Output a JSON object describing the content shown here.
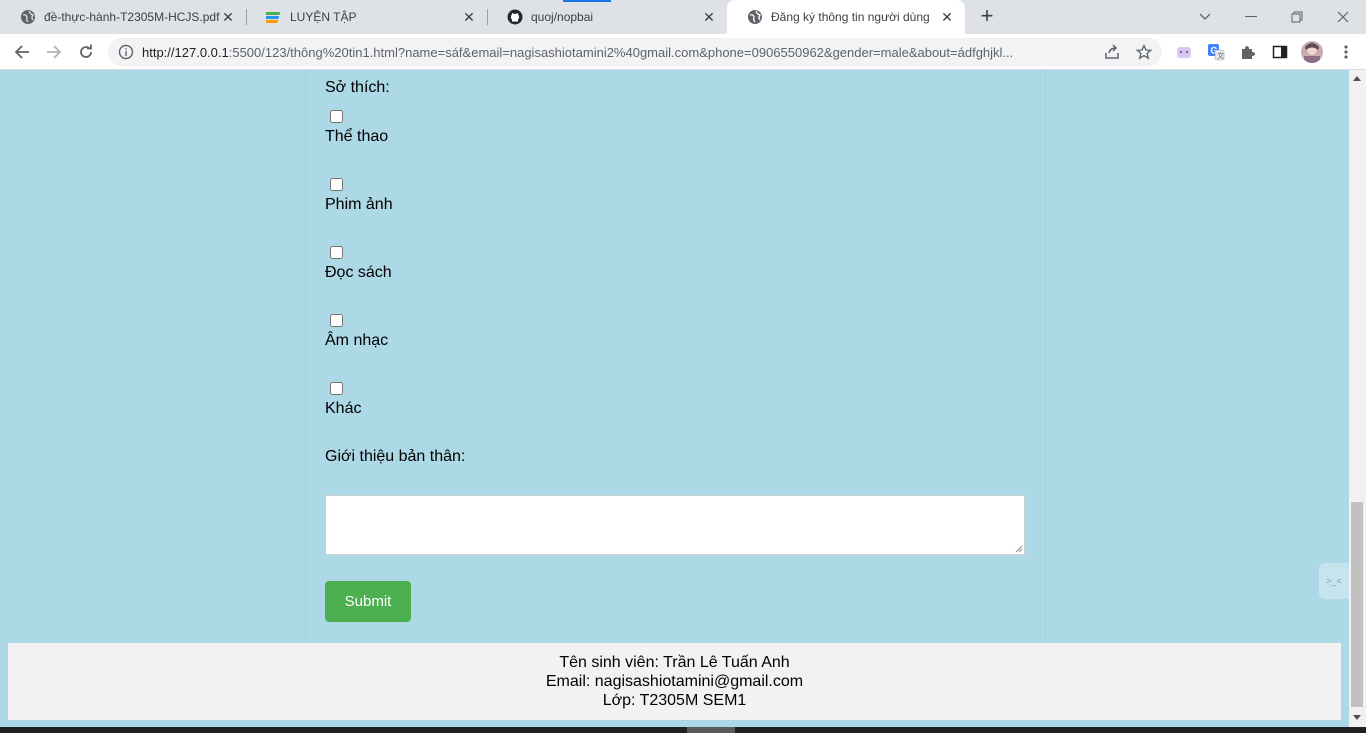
{
  "browser": {
    "tabs": [
      {
        "title": "đề-thực-hành-T2305M-HCJS.pdf",
        "icon": "globe-icon",
        "active": false
      },
      {
        "title": "LUYỆN TẬP",
        "icon": "colorful-logo-icon",
        "active": false
      },
      {
        "title": "quoj/nopbai",
        "icon": "github-icon",
        "active": false
      },
      {
        "title": "Đăng ký thông tin người dùng",
        "icon": "globe-icon",
        "active": true
      }
    ],
    "url_host": "http://127.0.0.1",
    "url_rest": ":5500/123/thông%20tin1.html?name=sáf&email=nagisashiotamini2%40gmail.com&phone=0906550962&gender=male&about=ádfghjkl..."
  },
  "form": {
    "hobbies_label": "Sở thích:",
    "hobbies": [
      {
        "label": "Thể thao",
        "checked": false
      },
      {
        "label": "Phim ảnh",
        "checked": false
      },
      {
        "label": "Đọc sách",
        "checked": false
      },
      {
        "label": "Âm nhạc",
        "checked": false
      },
      {
        "label": "Khác",
        "checked": false
      }
    ],
    "about_label": "Giới thiệu bản thân:",
    "about_value": "",
    "submit_label": "Submit"
  },
  "footer": {
    "student_name": "Tên sinh viên: Trần Lê Tuấn Anh",
    "email": "Email: nagisashiotamini@gmail.com",
    "class": "Lớp: T2305M SEM1"
  },
  "floating_widget_text": ">_<",
  "colors": {
    "page_background": "#add8e6",
    "submit_button": "#4caf50",
    "footer_background": "#f2f2f2"
  }
}
